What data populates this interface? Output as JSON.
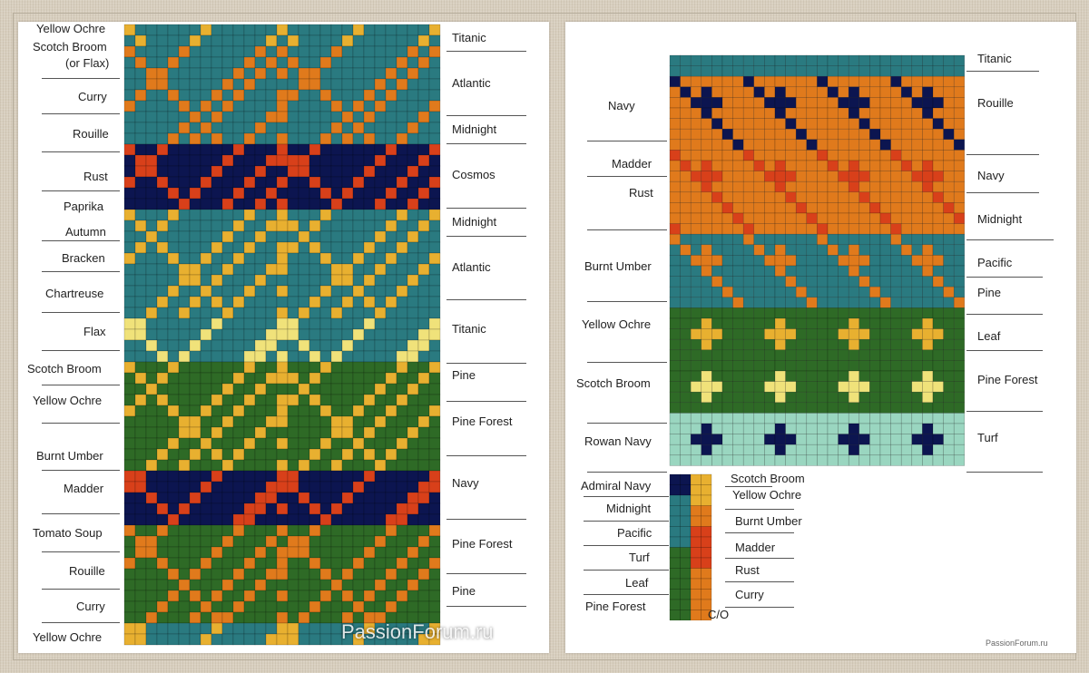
{
  "left_chart": {
    "left_labels": [
      "Yellow Ochre",
      "Scotch Broom",
      "(or Flax)",
      "Curry",
      "Rouille",
      "Rust",
      "Paprika",
      "Autumn",
      "Bracken",
      "Chartreuse",
      "Flax",
      "Scotch Broom",
      "Yellow Ochre",
      "Burnt Umber",
      "Madder",
      "Tomato Soup",
      "Rouille",
      "Curry",
      "Yellow Ochre"
    ],
    "right_labels": [
      "Titanic",
      "Atlantic",
      "Midnight",
      "Cosmos",
      "Midnight",
      "Atlantic",
      "Titanic",
      "Pine",
      "Pine Forest",
      "Navy",
      "Pine Forest",
      "Pine"
    ],
    "watermark": "PassionForum.ru"
  },
  "right_chart": {
    "left_labels": [
      "Navy",
      "Madder",
      "Rust",
      "Burnt Umber",
      "Yellow Ochre",
      "Scotch Broom",
      "Rowan Navy"
    ],
    "right_labels": [
      "Titanic",
      "Rouille",
      "Navy",
      "Midnight",
      "Pacific",
      "Pine",
      "Leaf",
      "Pine Forest",
      "Turf"
    ],
    "key_left_labels": [
      "Admiral Navy",
      "Midnight",
      "Pacific",
      "Turf",
      "Leaf",
      "Pine Forest"
    ],
    "key_right_labels": [
      "Scotch Broom",
      "Yellow Ochre",
      "Burnt Umber",
      "Madder",
      "Rust",
      "Curry"
    ],
    "cast_on_label": "C/O",
    "watermark": "PassionForum.ru"
  },
  "colors": {
    "navy": "#0c1550",
    "teal": "#2a7a80",
    "orange": "#e07a1c",
    "rust": "#d8401a",
    "ochre": "#e8b030",
    "green": "#2e6a26",
    "mint": "#9ad6c0",
    "cream": "#f0e27a"
  }
}
